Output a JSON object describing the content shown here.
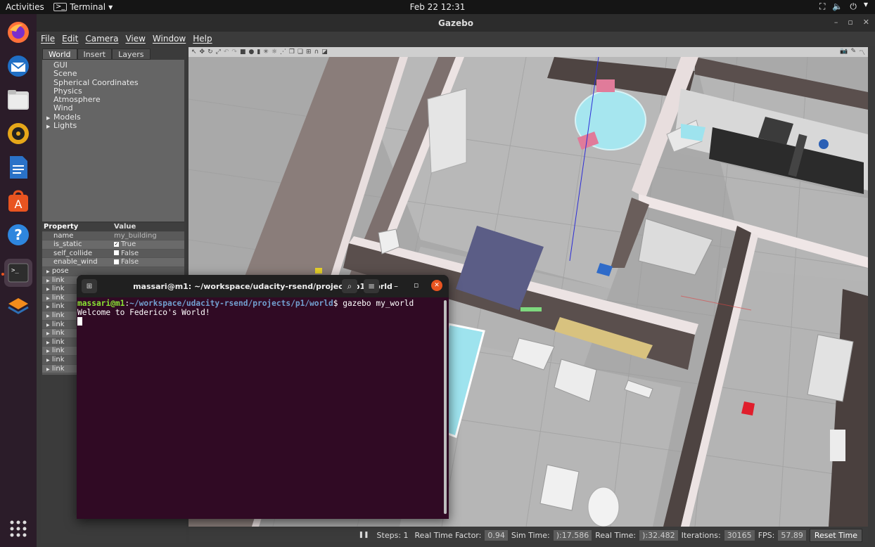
{
  "topbar": {
    "activities": "Activities",
    "app_name": "Terminal",
    "clock": "Feb 22  12:31"
  },
  "dock": {
    "items": [
      "firefox",
      "thunderbird",
      "files",
      "rhythmbox",
      "libreoffice-writer",
      "app-center",
      "help",
      "terminal",
      "layers-app",
      "show-apps"
    ]
  },
  "gazebo": {
    "title": "Gazebo",
    "menu": [
      "File",
      "Edit",
      "Camera",
      "View",
      "Window",
      "Help"
    ],
    "tabs": [
      "World",
      "Insert",
      "Layers"
    ],
    "tree": [
      {
        "label": "GUI",
        "expandable": false
      },
      {
        "label": "Scene",
        "expandable": false
      },
      {
        "label": "Spherical Coordinates",
        "expandable": false
      },
      {
        "label": "Physics",
        "expandable": false
      },
      {
        "label": "Atmosphere",
        "expandable": false
      },
      {
        "label": "Wind",
        "expandable": false
      },
      {
        "label": "Models",
        "expandable": true
      },
      {
        "label": "Lights",
        "expandable": true
      }
    ],
    "props_header": {
      "property": "Property",
      "value": "Value"
    },
    "props": [
      {
        "key": "name",
        "value": "my_building",
        "checkbox": null
      },
      {
        "key": "is_static",
        "value": "True",
        "checkbox": true
      },
      {
        "key": "self_collide",
        "value": "False",
        "checkbox": false
      },
      {
        "key": "enable_wind",
        "value": "False",
        "checkbox": false
      }
    ],
    "groups": [
      "pose",
      "link",
      "link",
      "link",
      "link",
      "link",
      "link",
      "link",
      "link",
      "link",
      "link",
      "link"
    ],
    "status": {
      "steps_label": "Steps: 1",
      "rtf_label": "Real Time Factor:",
      "rtf": "0.94",
      "sim_label": "Sim Time:",
      "sim": "):17.586",
      "real_label": "Real Time:",
      "real": "):32.482",
      "iter_label": "Iterations:",
      "iter": "30165",
      "fps_label": "FPS:",
      "fps": "57.89",
      "reset": "Reset Time"
    }
  },
  "terminal": {
    "title": "massari@m1: ~/workspace/udacity-rsend/projects/p1/world",
    "prompt_user": "massari@m1",
    "prompt_path": "~/workspace/udacity-rsend/projects/p1/world",
    "command": "$ gazebo my_world",
    "output": "Welcome to Federico's World!"
  },
  "colors": {
    "terminal_bg": "#300a24",
    "prompt_green": "#8ae234",
    "prompt_blue": "#729fcf",
    "ubuntu_orange": "#e95420"
  }
}
